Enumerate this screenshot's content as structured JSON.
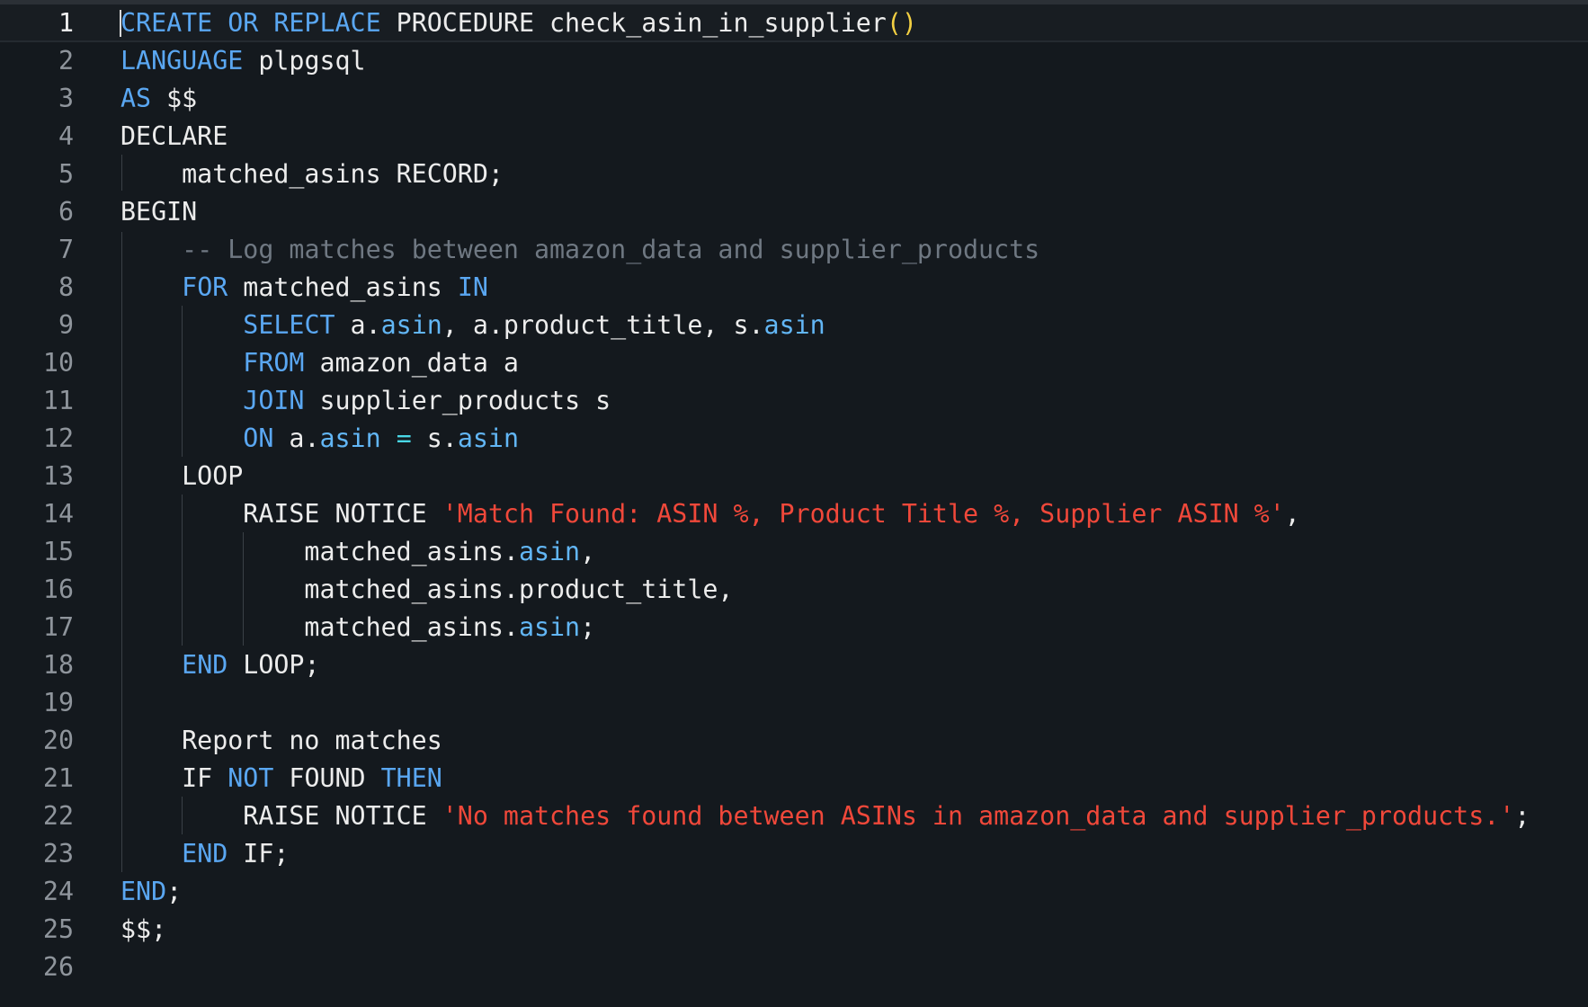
{
  "editor": {
    "lines": [
      {
        "n": "1",
        "tokens": [
          [
            "kw",
            "CREATE OR REPLACE"
          ],
          [
            "plain",
            " PROCEDURE check_asin_in_supplier"
          ],
          [
            "paren",
            "()"
          ]
        ]
      },
      {
        "n": "2",
        "tokens": [
          [
            "kw",
            "LANGUAGE"
          ],
          [
            "plain",
            " plpgsql"
          ]
        ]
      },
      {
        "n": "3",
        "tokens": [
          [
            "kw",
            "AS"
          ],
          [
            "plain",
            " $$"
          ]
        ]
      },
      {
        "n": "4",
        "tokens": [
          [
            "plain",
            "DECLARE"
          ]
        ]
      },
      {
        "n": "5",
        "tokens": [
          [
            "plain",
            "    matched_asins RECORD;"
          ]
        ]
      },
      {
        "n": "6",
        "tokens": [
          [
            "plain",
            "BEGIN"
          ]
        ]
      },
      {
        "n": "7",
        "tokens": [
          [
            "plain",
            "    "
          ],
          [
            "cm",
            "-- Log matches between amazon_data and supplier_products"
          ]
        ]
      },
      {
        "n": "8",
        "tokens": [
          [
            "plain",
            "    "
          ],
          [
            "kw",
            "FOR"
          ],
          [
            "plain",
            " matched_asins "
          ],
          [
            "kw",
            "IN"
          ]
        ]
      },
      {
        "n": "9",
        "tokens": [
          [
            "plain",
            "        "
          ],
          [
            "kw",
            "SELECT"
          ],
          [
            "plain",
            " a."
          ],
          [
            "kw2",
            "asin"
          ],
          [
            "plain",
            ", a.product_title, s."
          ],
          [
            "kw2",
            "asin"
          ]
        ]
      },
      {
        "n": "10",
        "tokens": [
          [
            "plain",
            "        "
          ],
          [
            "kw",
            "FROM"
          ],
          [
            "plain",
            " amazon_data a"
          ]
        ]
      },
      {
        "n": "11",
        "tokens": [
          [
            "plain",
            "        "
          ],
          [
            "kw",
            "JOIN"
          ],
          [
            "plain",
            " supplier_products s"
          ]
        ]
      },
      {
        "n": "12",
        "tokens": [
          [
            "plain",
            "        "
          ],
          [
            "kw",
            "ON"
          ],
          [
            "plain",
            " a."
          ],
          [
            "kw2",
            "asin"
          ],
          [
            "plain",
            " "
          ],
          [
            "op",
            "="
          ],
          [
            "plain",
            " s."
          ],
          [
            "kw2",
            "asin"
          ]
        ]
      },
      {
        "n": "13",
        "tokens": [
          [
            "plain",
            "    LOOP"
          ]
        ]
      },
      {
        "n": "14",
        "tokens": [
          [
            "plain",
            "        RAISE NOTICE "
          ],
          [
            "str",
            "'Match Found: ASIN %, Product Title %, Supplier ASIN %'"
          ],
          [
            "plain",
            ","
          ]
        ]
      },
      {
        "n": "15",
        "tokens": [
          [
            "plain",
            "            matched_asins."
          ],
          [
            "kw2",
            "asin"
          ],
          [
            "plain",
            ","
          ]
        ]
      },
      {
        "n": "16",
        "tokens": [
          [
            "plain",
            "            matched_asins.product_title,"
          ]
        ]
      },
      {
        "n": "17",
        "tokens": [
          [
            "plain",
            "            matched_asins."
          ],
          [
            "kw2",
            "asin"
          ],
          [
            "plain",
            ";"
          ]
        ]
      },
      {
        "n": "18",
        "tokens": [
          [
            "plain",
            "    "
          ],
          [
            "kw",
            "END"
          ],
          [
            "plain",
            " LOOP;"
          ]
        ]
      },
      {
        "n": "19",
        "tokens": []
      },
      {
        "n": "20",
        "tokens": [
          [
            "plain",
            "    Report no matches"
          ]
        ]
      },
      {
        "n": "21",
        "tokens": [
          [
            "plain",
            "    IF "
          ],
          [
            "kw",
            "NOT"
          ],
          [
            "plain",
            " FOUND "
          ],
          [
            "kw",
            "THEN"
          ]
        ]
      },
      {
        "n": "22",
        "tokens": [
          [
            "plain",
            "        RAISE NOTICE "
          ],
          [
            "str",
            "'No matches found between ASINs in amazon_data and supplier_products.'"
          ],
          [
            "plain",
            ";"
          ]
        ]
      },
      {
        "n": "23",
        "tokens": [
          [
            "plain",
            "    "
          ],
          [
            "kw",
            "END"
          ],
          [
            "plain",
            " IF;"
          ]
        ]
      },
      {
        "n": "24",
        "tokens": [
          [
            "kw",
            "END"
          ],
          [
            "plain",
            ";"
          ]
        ]
      },
      {
        "n": "25",
        "tokens": [
          [
            "plain",
            "$$;"
          ]
        ]
      },
      {
        "n": "26",
        "tokens": []
      }
    ],
    "active_line": 1
  }
}
